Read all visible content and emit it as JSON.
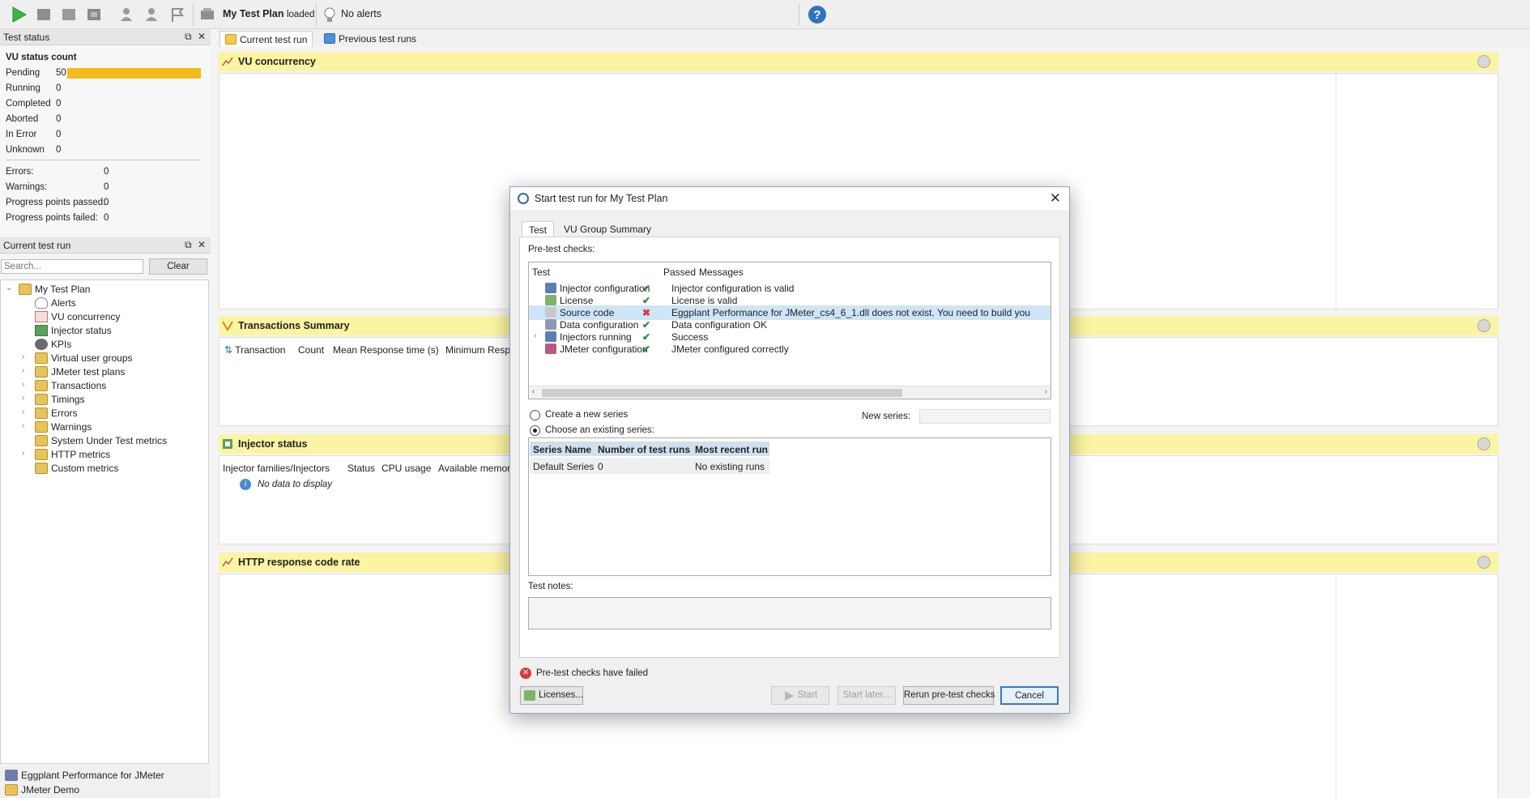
{
  "toolbar": {
    "plan_name": "My Test Plan",
    "plan_status": "loaded",
    "alerts_text": "No alerts"
  },
  "test_status": {
    "title": "Test status",
    "vu_title": "VU status count",
    "vu_rows": [
      {
        "label": "Pending",
        "value": "50"
      },
      {
        "label": "Running",
        "value": "0"
      },
      {
        "label": "Completed",
        "value": "0"
      },
      {
        "label": "Aborted",
        "value": "0"
      },
      {
        "label": "In Error",
        "value": "0"
      },
      {
        "label": "Unknown",
        "value": "0"
      }
    ],
    "pending_fraction": 1.0,
    "stats": [
      {
        "label": "Errors:",
        "value": "0"
      },
      {
        "label": "Warnings:",
        "value": "0"
      },
      {
        "label": "Progress points passed:",
        "value": "0"
      },
      {
        "label": "Progress points failed:",
        "value": "0"
      }
    ]
  },
  "current_run_panel": {
    "title": "Current test run",
    "search_placeholder": "Search...",
    "clear_label": "Clear",
    "tree": [
      {
        "label": "My Test Plan",
        "level": 0,
        "expander": "v"
      },
      {
        "label": "Alerts",
        "level": 1,
        "expander": ""
      },
      {
        "label": "VU concurrency",
        "level": 1,
        "expander": ""
      },
      {
        "label": "Injector status",
        "level": 1,
        "expander": ""
      },
      {
        "label": "KPIs",
        "level": 1,
        "expander": ""
      },
      {
        "label": "Virtual user groups",
        "level": 1,
        "expander": ">"
      },
      {
        "label": "JMeter test plans",
        "level": 1,
        "expander": ">"
      },
      {
        "label": "Transactions",
        "level": 1,
        "expander": ">"
      },
      {
        "label": "Timings",
        "level": 1,
        "expander": ">"
      },
      {
        "label": "Errors",
        "level": 1,
        "expander": ">"
      },
      {
        "label": "Warnings",
        "level": 1,
        "expander": ">"
      },
      {
        "label": "System Under Test metrics",
        "level": 1,
        "expander": ""
      },
      {
        "label": "HTTP metrics",
        "level": 1,
        "expander": ">"
      },
      {
        "label": "Custom metrics",
        "level": 1,
        "expander": ""
      }
    ],
    "footer": [
      "Eggplant Performance for JMeter",
      "JMeter Demo"
    ]
  },
  "main_tabs": [
    "Current test run",
    "Previous test runs"
  ],
  "sections": {
    "vu_concurrency": "VU concurrency",
    "transactions": {
      "title": "Transactions Summary",
      "columns": [
        "Transaction",
        "Count",
        "Mean Response time (s)",
        "Minimum Resp"
      ]
    },
    "injector": {
      "title": "Injector status",
      "columns": [
        "Injector families/Injectors",
        "Status",
        "CPU usage",
        "Available memor"
      ],
      "empty": "No data to display"
    },
    "http": "HTTP response code rate"
  },
  "dialog": {
    "title": "Start test run for My Test Plan",
    "tabs": [
      "Test",
      "VU Group Summary"
    ],
    "pretest_label": "Pre-test checks:",
    "checks_columns": [
      "Test",
      "Passed",
      "Messages"
    ],
    "checks": [
      {
        "test": "Injector configuration",
        "passed": "ok",
        "message": "Injector configuration is valid"
      },
      {
        "test": "License",
        "passed": "ok",
        "message": "License is valid"
      },
      {
        "test": "Source code",
        "passed": "fail",
        "message": "Eggplant Performance for JMeter_cs4_6_1.dll does not exist. You need to build you"
      },
      {
        "test": "Data configuration",
        "passed": "ok",
        "message": "Data configuration OK"
      },
      {
        "test": "Injectors running",
        "passed": "ok",
        "message": "Success"
      },
      {
        "test": "JMeter configuration",
        "passed": "ok",
        "message": "JMeter configured correctly"
      }
    ],
    "create_new_label": "Create a new series",
    "new_series_label": "New series:",
    "choose_existing_label": "Choose an existing series:",
    "series_columns": [
      "Series Name",
      "Number of test runs",
      "Most recent run"
    ],
    "series_rows": [
      {
        "name": "Default Series",
        "runs": "0",
        "recent": "No existing runs"
      }
    ],
    "notes_label": "Test notes:",
    "error_text": "Pre-test checks have failed",
    "buttons": {
      "licenses": "Licenses...",
      "start": "Start",
      "start_later": "Start later...",
      "rerun": "Rerun pre-test checks",
      "cancel": "Cancel"
    }
  },
  "colors": {
    "section_header": "#fbf4a2",
    "pending_bar": "#f2bd1a",
    "selected_row": "#cde5f7",
    "error": "#d9383a",
    "ok": "#2e8b3c"
  }
}
